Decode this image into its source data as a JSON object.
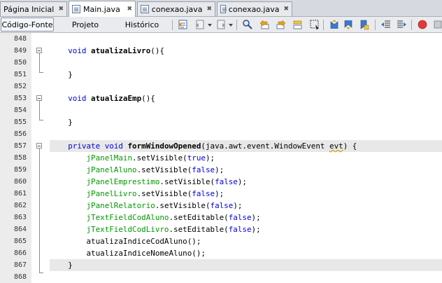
{
  "tabs": [
    {
      "label": "Página Inicial",
      "active": false
    },
    {
      "label": "Main.java",
      "active": true
    },
    {
      "label": "conexao.java",
      "active": false
    },
    {
      "label": "conexao.java",
      "active": false
    }
  ],
  "toolbar": {
    "source_label": "Código-Fonte",
    "design_label": "Projeto",
    "history_label": "Histórico"
  },
  "lines": [
    {
      "n": "848"
    },
    {
      "n": "849"
    },
    {
      "n": "850"
    },
    {
      "n": "851"
    },
    {
      "n": "852"
    },
    {
      "n": "853"
    },
    {
      "n": "854"
    },
    {
      "n": "855"
    },
    {
      "n": "856"
    },
    {
      "n": "857"
    },
    {
      "n": "858"
    },
    {
      "n": "859"
    },
    {
      "n": "860"
    },
    {
      "n": "861"
    },
    {
      "n": "862"
    },
    {
      "n": "863"
    },
    {
      "n": "864"
    },
    {
      "n": "865"
    },
    {
      "n": "866"
    },
    {
      "n": "867"
    },
    {
      "n": "868"
    }
  ],
  "code": {
    "l849": {
      "kw": "void",
      "name": "atualizaLivro",
      "rest": "(){"
    },
    "l851": {
      "text": "}"
    },
    "l853": {
      "kw": "void",
      "name": "atualizaEmp",
      "rest": "(){"
    },
    "l855": {
      "text": "}"
    },
    "l857": {
      "kw1": "private",
      "kw2": "void",
      "name": "formWindowOpened",
      "rest": "(java.awt.event.WindowEvent ",
      "evt": "evt",
      "tail": ") {"
    },
    "l858": {
      "var": "jPanelMain",
      "call": ".setVisible(",
      "lit": "true",
      "end": ");"
    },
    "l859": {
      "var": "jPanelAluno",
      "call": ".setVisible(",
      "lit": "false",
      "end": ");"
    },
    "l860": {
      "var": "jPanelEmprestimo",
      "call": ".setVisible(",
      "lit": "false",
      "end": ");"
    },
    "l861": {
      "var": "jPanelLivro",
      "call": ".setVisible(",
      "lit": "false",
      "end": ");"
    },
    "l862": {
      "var": "jPanelRelatorio",
      "call": ".setVisible(",
      "lit": "false",
      "end": ");"
    },
    "l863": {
      "var": "jTextFieldCodAluno",
      "call": ".setEditable(",
      "lit": "false",
      "end": ");"
    },
    "l864": {
      "var": "jTextFieldCodLivro",
      "call": ".setEditable(",
      "lit": "false",
      "end": ");"
    },
    "l865": {
      "text": "atualizaIndiceCodAluno();"
    },
    "l866": {
      "text": "atualizaIndiceNomeAluno();"
    },
    "l867": {
      "text": "}"
    }
  },
  "colors": {
    "keyword": "#0000e6",
    "field": "#009900",
    "current_line": "#e8e8e8"
  }
}
